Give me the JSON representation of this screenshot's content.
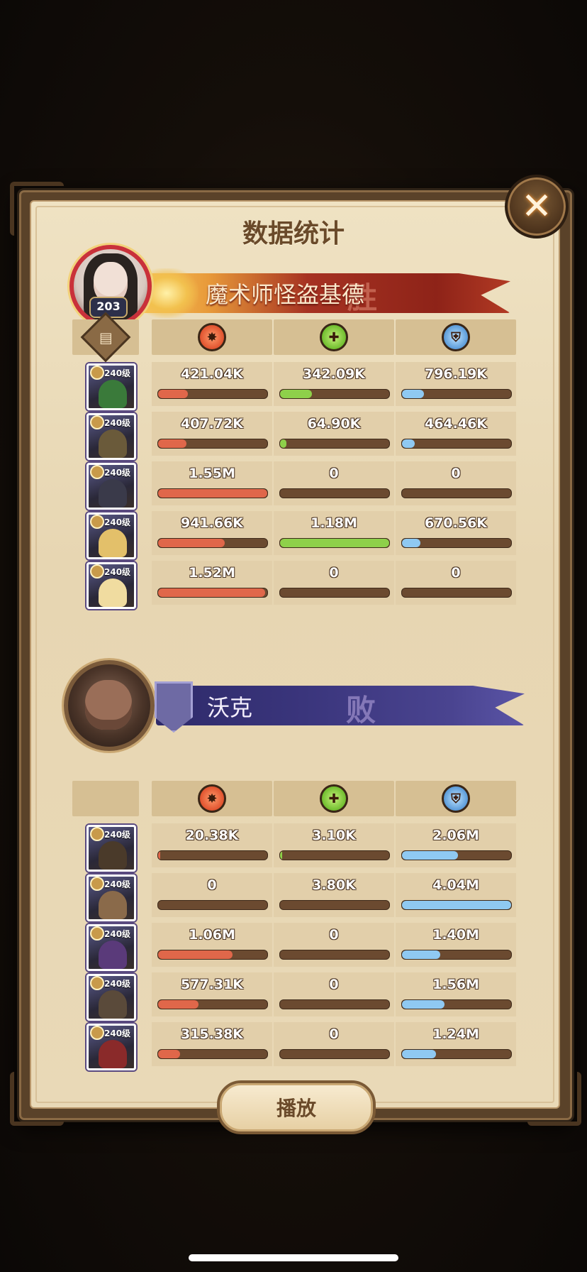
{
  "title": "数据统计",
  "close_icon": "close-icon",
  "play_button_label": "播放",
  "stat_icons": [
    "damage-icon",
    "healing-icon",
    "shield-icon"
  ],
  "log_icon": "battle-log-icon",
  "colors": {
    "damage_bar": "#e0674a",
    "healing_bar": "#8ed04a",
    "shield_bar": "#8fc9f2",
    "winner_banner": "#a63222",
    "loser_banner": "#3a357c"
  },
  "winner": {
    "name": "魔术师怪盗基德",
    "level": "203",
    "stamp": "胜",
    "heroes": [
      {
        "level": "240级",
        "damage": "421.04K",
        "healing": "342.09K",
        "shield": "796.19K",
        "damage_frac": 0.27,
        "healing_frac": 0.29,
        "shield_frac": 0.2
      },
      {
        "level": "240级",
        "damage": "407.72K",
        "healing": "64.90K",
        "shield": "464.46K",
        "damage_frac": 0.26,
        "healing_frac": 0.06,
        "shield_frac": 0.12
      },
      {
        "level": "240级",
        "damage": "1.55M",
        "healing": "0",
        "shield": "0",
        "damage_frac": 1.0,
        "healing_frac": 0,
        "shield_frac": 0
      },
      {
        "level": "240级",
        "damage": "941.66K",
        "healing": "1.18M",
        "shield": "670.56K",
        "damage_frac": 0.61,
        "healing_frac": 1.0,
        "shield_frac": 0.17
      },
      {
        "level": "240级",
        "damage": "1.52M",
        "healing": "0",
        "shield": "0",
        "damage_frac": 0.98,
        "healing_frac": 0,
        "shield_frac": 0
      }
    ]
  },
  "loser": {
    "name": "沃克",
    "stamp": "败",
    "heroes": [
      {
        "level": "240级",
        "damage": "20.38K",
        "healing": "3.10K",
        "shield": "2.06M",
        "damage_frac": 0.02,
        "healing_frac": 0.02,
        "shield_frac": 0.51
      },
      {
        "level": "240级",
        "damage": "0",
        "healing": "3.80K",
        "shield": "4.04M",
        "damage_frac": 0,
        "healing_frac": 0.0,
        "shield_frac": 1.0
      },
      {
        "level": "240级",
        "damage": "1.06M",
        "healing": "0",
        "shield": "1.40M",
        "damage_frac": 0.68,
        "healing_frac": 0,
        "shield_frac": 0.35
      },
      {
        "level": "240级",
        "damage": "577.31K",
        "healing": "0",
        "shield": "1.56M",
        "damage_frac": 0.37,
        "healing_frac": 0,
        "shield_frac": 0.39
      },
      {
        "level": "240级",
        "damage": "315.38K",
        "healing": "0",
        "shield": "1.24M",
        "damage_frac": 0.2,
        "healing_frac": 0,
        "shield_frac": 0.31
      }
    ]
  }
}
